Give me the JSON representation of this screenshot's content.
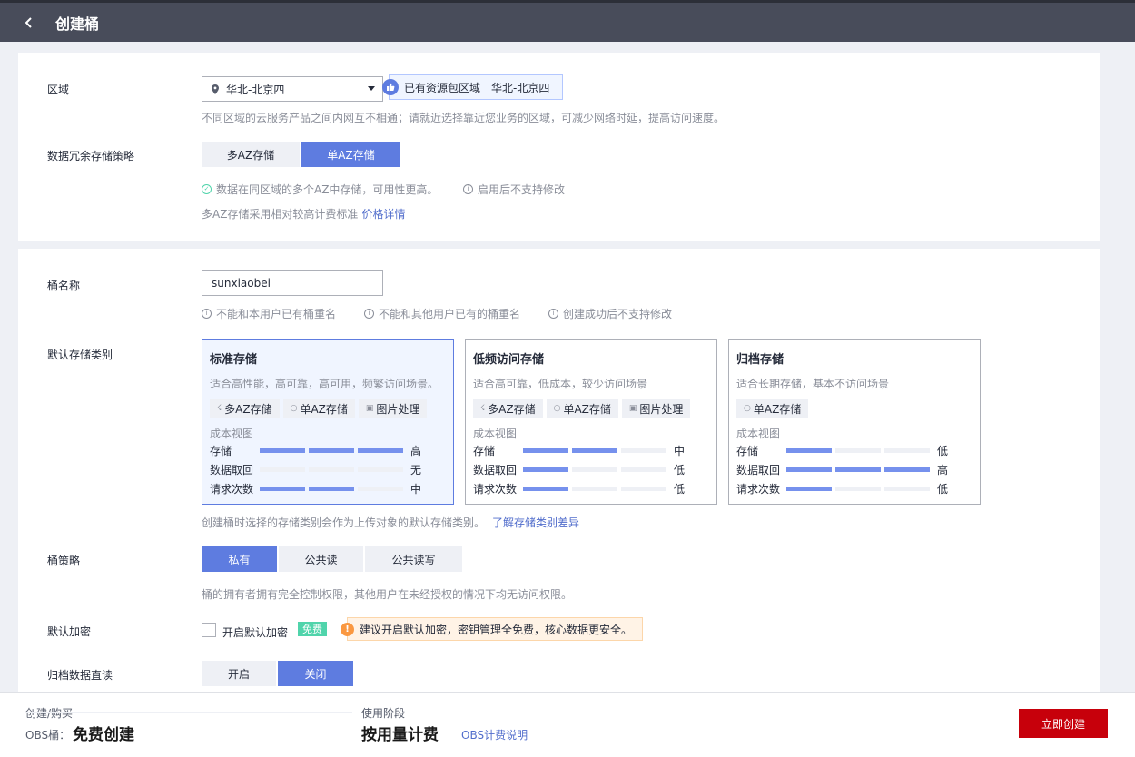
{
  "header": {
    "title": "创建桶"
  },
  "region": {
    "label": "区域",
    "selected": "华北-北京四",
    "resource_tag_text": "已有资源包区域",
    "resource_tag_region": "华北-北京四",
    "hint": "不同区域的云服务产品之间内网互不相通；请就近选择靠近您业务的区域，可减少网络时延，提高访问速度。"
  },
  "redundancy": {
    "label": "数据冗余存储策略",
    "options": [
      "多AZ存储",
      "单AZ存储"
    ],
    "selected_index": 1,
    "hint1": "数据在同区域的多个AZ中存储，可用性更高。",
    "hint2": "启用后不支持修改",
    "price_hint": "多AZ存储采用相对较高计费标准",
    "price_link": "价格详情"
  },
  "bucket_name": {
    "label": "桶名称",
    "value": "sunxiaobei",
    "rules": [
      "不能和本用户已有桶重名",
      "不能和其他用户已有的桶重名",
      "创建成功后不支持修改"
    ]
  },
  "storage_class": {
    "label": "默认存储类别",
    "cost_view_label": "成本视图",
    "row_labels": [
      "存储",
      "数据取回",
      "请求次数"
    ],
    "cards": [
      {
        "title": "标准存储",
        "desc": "适合高性能，高可靠，高可用，频繁访问场景。",
        "tags": [
          {
            "icon": "multi-az-icon",
            "label": "多AZ存储"
          },
          {
            "icon": "single-az-icon",
            "label": "单AZ存储"
          },
          {
            "icon": "image-icon",
            "label": "图片处理"
          }
        ],
        "levels": [
          {
            "filled": 3,
            "text": "高"
          },
          {
            "filled": 0,
            "text": "无"
          },
          {
            "filled": 2,
            "text": "中"
          }
        ]
      },
      {
        "title": "低频访问存储",
        "desc": "适合高可靠，低成本，较少访问场景",
        "tags": [
          {
            "icon": "multi-az-icon",
            "label": "多AZ存储"
          },
          {
            "icon": "single-az-icon",
            "label": "单AZ存储"
          },
          {
            "icon": "image-icon",
            "label": "图片处理"
          }
        ],
        "levels": [
          {
            "filled": 2,
            "text": "中"
          },
          {
            "filled": 1,
            "text": "低"
          },
          {
            "filled": 1,
            "text": "低"
          }
        ]
      },
      {
        "title": "归档存储",
        "desc": "适合长期存储，基本不访问场景",
        "tags": [
          {
            "icon": "single-az-icon",
            "label": "单AZ存储"
          }
        ],
        "levels": [
          {
            "filled": 1,
            "text": "低"
          },
          {
            "filled": 3,
            "text": "高"
          },
          {
            "filled": 1,
            "text": "低"
          }
        ]
      }
    ],
    "selected_index": 0,
    "hint": "创建桶时选择的存储类别会作为上传对象的默认存储类别。",
    "hint_link": "了解存储类别差异"
  },
  "policy": {
    "label": "桶策略",
    "options": [
      "私有",
      "公共读",
      "公共读写"
    ],
    "selected_index": 0,
    "hint": "桶的拥有者拥有完全控制权限，其他用户在未经授权的情况下均无访问权限。"
  },
  "encryption": {
    "label": "默认加密",
    "checkbox_label": "开启默认加密",
    "badge": "免费",
    "tip": "建议开启默认加密，密钥管理全免费，核心数据更安全。",
    "checked": false
  },
  "archive_read": {
    "label": "归档数据直读",
    "options": [
      "开启",
      "关闭"
    ],
    "selected_index": 1
  },
  "footer": {
    "create_label": "创建/购买",
    "obs_label": "OBS桶：",
    "obs_value": "免费创建",
    "usage_label": "使用阶段",
    "usage_value": "按用量计费",
    "price_link": "OBS计费说明",
    "create_button": "立即创建"
  },
  "colors": {
    "accent": "#5e7ce0",
    "create_button": "#c7000b",
    "header_bg": "#484c5a"
  }
}
